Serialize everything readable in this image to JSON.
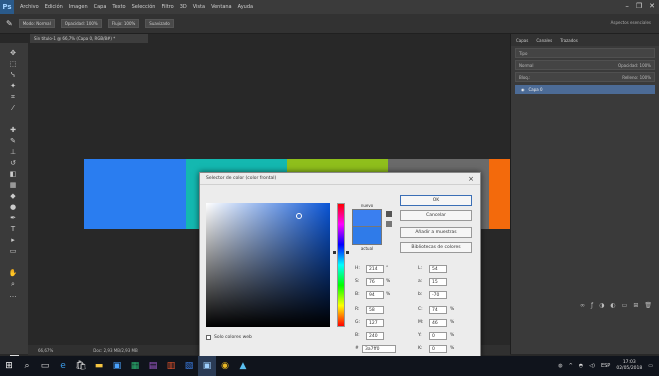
{
  "app": {
    "logo": "Ps",
    "window_controls": [
      "–",
      "❐",
      "✕"
    ]
  },
  "menubar": {
    "items": [
      "Archivo",
      "Edición",
      "Imagen",
      "Capa",
      "Texto",
      "Selección",
      "Filtro",
      "3D",
      "Vista",
      "Ventana",
      "Ayuda"
    ]
  },
  "optbar": {
    "tool_icon": "brush-icon",
    "fields": [
      "Modo: Normal",
      "Opacidad: 100%",
      "Flujo: 100%",
      "Suavizado"
    ],
    "workspace": "Aspectos esenciales"
  },
  "document": {
    "tab_label": "Sin título-1 @ 66,7% (Capa 0, RGB/8#) *",
    "status_zoom": "66,67%",
    "status_info": "Doc: 2,93 MB/2,93 MB"
  },
  "canvas": {
    "strips": [
      {
        "color": "#2a7df0"
      },
      {
        "color": "#14b8b0"
      },
      {
        "color": "#8fbf1c"
      },
      {
        "color": "#6a6a6a"
      },
      {
        "color": "#f36a0c"
      }
    ]
  },
  "panel": {
    "tabs": [
      "Capas",
      "Canales",
      "Trazados"
    ],
    "kind_filter": "Tipo",
    "blend_mode": "Normal",
    "opacity": "Opacidad: 100%",
    "fill": "Relleno: 100%",
    "lock_label": "Bloq.:",
    "layer_name": "Capa 0"
  },
  "color_picker": {
    "title": "Selector de color (color frontal)",
    "new_label": "nuevo",
    "current_label": "actual",
    "new_color": "#3a7ff0",
    "current_color": "#2f7be9",
    "buttons": {
      "ok": "OK",
      "cancel": "Cancelar",
      "add_swatch": "Añadir a muestras",
      "libraries": "Bibliotecas de colores"
    },
    "hsb": [
      {
        "label": "H:",
        "value": "214",
        "unit": "°"
      },
      {
        "label": "S:",
        "value": "76",
        "unit": "%"
      },
      {
        "label": "B:",
        "value": "94",
        "unit": "%"
      }
    ],
    "rgb": [
      {
        "label": "R:",
        "value": "58"
      },
      {
        "label": "G:",
        "value": "127"
      },
      {
        "label": "B:",
        "value": "240"
      }
    ],
    "lab": [
      {
        "label": "L:",
        "value": "54"
      },
      {
        "label": "a:",
        "value": "15"
      },
      {
        "label": "b:",
        "value": "-70"
      }
    ],
    "cmyk": [
      {
        "label": "C:",
        "value": "74",
        "unit": "%"
      },
      {
        "label": "M:",
        "value": "46",
        "unit": "%"
      },
      {
        "label": "Y:",
        "value": "0",
        "unit": "%"
      },
      {
        "label": "K:",
        "value": "0",
        "unit": "%"
      }
    ],
    "hex_label": "#",
    "hex_value": "3a7ff0",
    "web_colors_label": "Solo colores web"
  },
  "taskbar": {
    "icons": [
      "windows-icon",
      "search-icon",
      "task-view-icon",
      "edge-icon",
      "store-icon",
      "explorer-icon",
      "photoshop-icon",
      "excel-icon",
      "onenote-icon",
      "powerpoint-icon",
      "word-icon",
      "photoshop-active-icon",
      "chrome-icon",
      "photos-icon"
    ],
    "time": "17:03",
    "date": "02/05/2018",
    "lang": "ESP"
  }
}
